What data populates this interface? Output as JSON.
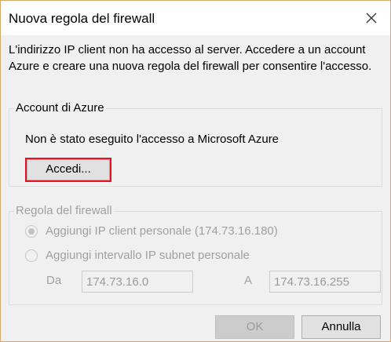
{
  "window": {
    "title": "Nuova regola del firewall",
    "close_icon": "close-icon"
  },
  "message": "L'indirizzo IP client non ha accesso al server. Accedere a un account Azure e creare una nuova regola del firewall per consentire l'accesso.",
  "azure_account": {
    "legend": "Account di Azure",
    "status": "Non è stato eseguito l'accesso a Microsoft Azure",
    "login_label": "Accedi..."
  },
  "firewall_rule": {
    "legend": "Regola del firewall",
    "enabled": false,
    "options": [
      {
        "label": "Aggiungi IP client personale (174.73.16.180)",
        "selected": true
      },
      {
        "label": "Aggiungi intervallo IP subnet personale",
        "selected": false
      }
    ],
    "range": {
      "from_label": "Da",
      "from_value": "174.73.16.0",
      "to_label": "A",
      "to_value": "174.73.16.255"
    }
  },
  "buttons": {
    "ok_label": "OK",
    "ok_enabled": false,
    "cancel_label": "Annulla"
  },
  "colors": {
    "window_border": "#d9a96a",
    "highlight_border": "#e81123",
    "dialog_background": "#f0f0f0",
    "disabled_text": "#a0a0a0"
  }
}
